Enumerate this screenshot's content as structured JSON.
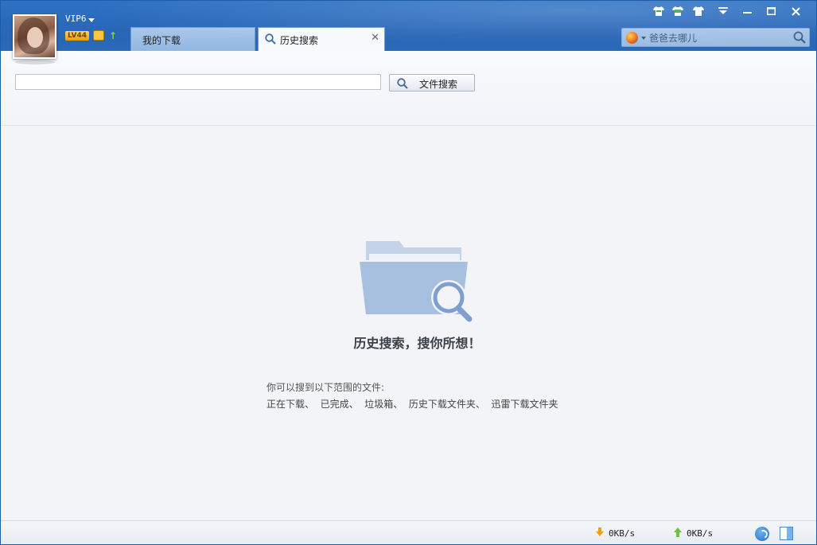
{
  "header": {
    "vip_label": "VIP6",
    "level_badge": "LV44"
  },
  "tabs": [
    {
      "label": "我的下载"
    },
    {
      "label": "历史搜索"
    }
  ],
  "top_search": {
    "placeholder": "爸爸去哪儿"
  },
  "file_search": {
    "input_value": "",
    "button_label": "文件搜索"
  },
  "empty_state": {
    "title": "历史搜索，搜你所想！",
    "hint_line1": "你可以搜到以下范围的文件:",
    "hint_line2": "正在下载、  已完成、  垃圾箱、  历史下载文件夹、  迅雷下载文件夹"
  },
  "statusbar": {
    "download_speed": "0KB/s",
    "upload_speed": "0KB/s"
  },
  "icons": {
    "skin_1": "shirt-icon",
    "skin_2": "shirt-icon",
    "skin_3": "shirt-icon",
    "menu": "menu-dropdown-icon",
    "minimize": "minimize-icon",
    "maximize": "maximize-icon",
    "close": "close-icon",
    "search": "search-icon",
    "folder": "folder-search-icon"
  },
  "colors": {
    "titlebar": "#2b6ab9",
    "accent_orange": "#f0a010",
    "upload_green": "#6cc23a"
  }
}
